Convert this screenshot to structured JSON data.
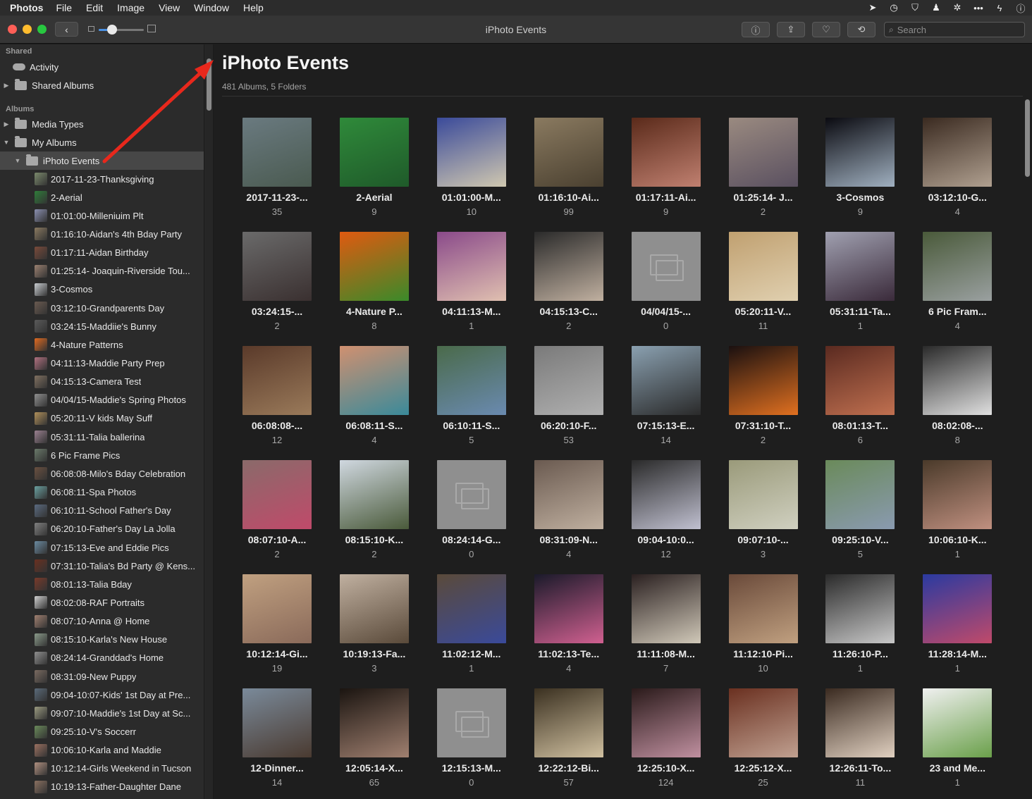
{
  "menubar": {
    "app": "Photos",
    "items": [
      "File",
      "Edit",
      "Image",
      "View",
      "Window",
      "Help"
    ],
    "status_icons": [
      "location-arrow-icon",
      "clock-icon",
      "shield-icon",
      "user-icon",
      "gear-icon",
      "dots-icon",
      "bolt-icon",
      "info-icon"
    ]
  },
  "toolbar": {
    "title": "iPhoto Events",
    "zoom_level": 0.3,
    "search_placeholder": "Search",
    "buttons": [
      "info-icon",
      "share-icon",
      "heart-icon",
      "rotate-icon"
    ]
  },
  "sidebar": {
    "shared_header": "Shared",
    "activity": "Activity",
    "shared_albums": "Shared Albums",
    "albums_header": "Albums",
    "media_types": "Media Types",
    "my_albums": "My Albums",
    "iphoto_events": "iPhoto Events",
    "events": [
      {
        "name": "2017-11-23-Thanksgiving",
        "color": "#7b8a6c"
      },
      {
        "name": "2-Aerial",
        "color": "#2f7d3a"
      },
      {
        "name": "01:01:00-Milleniuim Plt",
        "color": "#8a8fb0"
      },
      {
        "name": "01:16:10-Aidan's 4th Bday Party",
        "color": "#8a7a60"
      },
      {
        "name": "01:17:11-Aidan Birthday",
        "color": "#7a4a3a"
      },
      {
        "name": "01:25:14- Joaquin-Riverside Tou...",
        "color": "#9a8070"
      },
      {
        "name": "3-Cosmos",
        "color": "#c8ccd0"
      },
      {
        "name": "03:12:10-Grandparents Day",
        "color": "#6a5a50"
      },
      {
        "name": "03:24:15-Maddiie's Bunny",
        "color": "#5a5a5a"
      },
      {
        "name": "4-Nature Patterns",
        "color": "#e06a20"
      },
      {
        "name": "04:11:13-Maddie Party Prep",
        "color": "#b07080"
      },
      {
        "name": "04:15:13-Camera Test",
        "color": "#807060"
      },
      {
        "name": "04/04/15-Maddie's Spring Photos",
        "color": "#8f8f8f"
      },
      {
        "name": "05:20:11-V kids May Suff",
        "color": "#b0905a"
      },
      {
        "name": "05:31:11-Talia ballerina",
        "color": "#9a8090"
      },
      {
        "name": "6 Pic Frame Pics",
        "color": "#6a7a6a"
      },
      {
        "name": "06:08:08-Milo's Bday Celebration",
        "color": "#6a5040"
      },
      {
        "name": "06:08:11-Spa Photos",
        "color": "#6aa0a0"
      },
      {
        "name": "06:10:11-School Father's Day",
        "color": "#5a6a80"
      },
      {
        "name": "06:20:10-Father's Day La Jolla",
        "color": "#808080"
      },
      {
        "name": "07:15:13-Eve and Eddie Pics",
        "color": "#6a8aa0"
      },
      {
        "name": "07:31:10-Talia's Bd Party @ Kens...",
        "color": "#6a3020"
      },
      {
        "name": "08:01:13-Talia Bday",
        "color": "#7a3a2a"
      },
      {
        "name": "08:02:08-RAF Portraits",
        "color": "#d0d0d0"
      },
      {
        "name": "08:07:10-Anna @ Home",
        "color": "#a08070"
      },
      {
        "name": "08:15:10-Karla's New House",
        "color": "#8a9a8a"
      },
      {
        "name": "08:24:14-Granddad's Home",
        "color": "#8f8f8f"
      },
      {
        "name": "08:31:09-New Puppy",
        "color": "#7a6a60"
      },
      {
        "name": "09:04-10:07-Kids' 1st Day at Pre...",
        "color": "#5a6a7a"
      },
      {
        "name": "09:07:10-Maddie's 1st Day at Sc...",
        "color": "#9a9a80"
      },
      {
        "name": "09:25:10-V's Soccerr",
        "color": "#6a8a5a"
      },
      {
        "name": "10:06:10-Karla and Maddie",
        "color": "#9a7060"
      },
      {
        "name": "10:12:14-Girls Weekend in Tucson",
        "color": "#b09080"
      },
      {
        "name": "10:19:13-Father-Daughter Dane",
        "color": "#8a7060"
      }
    ]
  },
  "main": {
    "title": "iPhoto Events",
    "subtitle": "481 Albums, 5 Folders",
    "albums": [
      {
        "name": "2017-11-23-...",
        "count": "35",
        "c1": "#6a7a80",
        "c2": "#4a5a50"
      },
      {
        "name": "2-Aerial",
        "count": "9",
        "c1": "#2f8a3a",
        "c2": "#1f5a2a"
      },
      {
        "name": "01:01:00-M...",
        "count": "10",
        "c1": "#3a4a9a",
        "c2": "#d0c8b0"
      },
      {
        "name": "01:16:10-Ai...",
        "count": "99",
        "c1": "#8a7a60",
        "c2": "#4a4030"
      },
      {
        "name": "01:17:11-Ai...",
        "count": "9",
        "c1": "#5a2a1a",
        "c2": "#c08070"
      },
      {
        "name": "01:25:14- J...",
        "count": "2",
        "c1": "#9a8a80",
        "c2": "#5a5060"
      },
      {
        "name": "3-Cosmos",
        "count": "9",
        "c1": "#0a0a10",
        "c2": "#a0b0c0"
      },
      {
        "name": "03:12:10-G...",
        "count": "4",
        "c1": "#3a2a20",
        "c2": "#b0a090"
      },
      {
        "name": "03:24:15-...",
        "count": "2",
        "c1": "#6a6a6a",
        "c2": "#3a3030"
      },
      {
        "name": "4-Nature P...",
        "count": "8",
        "c1": "#e05a10",
        "c2": "#3a8a2a"
      },
      {
        "name": "04:11:13-M...",
        "count": "1",
        "c1": "#8a4a8a",
        "c2": "#e0c0b0"
      },
      {
        "name": "04:15:13-C...",
        "count": "2",
        "c1": "#2a2a2a",
        "c2": "#c0b0a0"
      },
      {
        "name": "04/04/15-...",
        "count": "0",
        "empty": true
      },
      {
        "name": "05:20:11-V...",
        "count": "11",
        "c1": "#c0a070",
        "c2": "#e0d0b0"
      },
      {
        "name": "05:31:11-Ta...",
        "count": "1",
        "c1": "#a0a0b0",
        "c2": "#3a2a3a"
      },
      {
        "name": "6 Pic Fram...",
        "count": "4",
        "c1": "#4a5a3a",
        "c2": "#9aa0a0"
      },
      {
        "name": "06:08:08-...",
        "count": "12",
        "c1": "#5a3a2a",
        "c2": "#9a7a5a"
      },
      {
        "name": "06:08:11-S...",
        "count": "4",
        "c1": "#d09070",
        "c2": "#3a8a9a"
      },
      {
        "name": "06:10:11-S...",
        "count": "5",
        "c1": "#4a6a4a",
        "c2": "#6a8ab0"
      },
      {
        "name": "06:20:10-F...",
        "count": "53",
        "c1": "#7a7a7a",
        "c2": "#b0b0b0"
      },
      {
        "name": "07:15:13-E...",
        "count": "14",
        "c1": "#8aa0b0",
        "c2": "#2a2a2a"
      },
      {
        "name": "07:31:10-T...",
        "count": "2",
        "c1": "#1a1010",
        "c2": "#e07020"
      },
      {
        "name": "08:01:13-T...",
        "count": "6",
        "c1": "#5a2a20",
        "c2": "#c07050"
      },
      {
        "name": "08:02:08-...",
        "count": "8",
        "c1": "#2a2a2a",
        "c2": "#e0e0e0"
      },
      {
        "name": "08:07:10-A...",
        "count": "2",
        "c1": "#8a6a6a",
        "c2": "#c04a6a"
      },
      {
        "name": "08:15:10-K...",
        "count": "2",
        "c1": "#d0d8e0",
        "c2": "#4a5a3a"
      },
      {
        "name": "08:24:14-G...",
        "count": "0",
        "empty": true
      },
      {
        "name": "08:31:09-N...",
        "count": "4",
        "c1": "#6a5a50",
        "c2": "#c0b0a0"
      },
      {
        "name": "09:04-10:0...",
        "count": "12",
        "c1": "#2a2a2a",
        "c2": "#c0c0d0"
      },
      {
        "name": "09:07:10-...",
        "count": "3",
        "c1": "#9a9a7a",
        "c2": "#d0d0c0"
      },
      {
        "name": "09:25:10-V...",
        "count": "5",
        "c1": "#6a8a5a",
        "c2": "#8a9ab0"
      },
      {
        "name": "10:06:10-K...",
        "count": "1",
        "c1": "#4a3a2a",
        "c2": "#c09080"
      },
      {
        "name": "10:12:14-Gi...",
        "count": "19",
        "c1": "#c0a080",
        "c2": "#8a6a5a"
      },
      {
        "name": "10:19:13-Fa...",
        "count": "3",
        "c1": "#c0b0a0",
        "c2": "#5a4a3a"
      },
      {
        "name": "11:02:12-M...",
        "count": "1",
        "c1": "#5a4a3a",
        "c2": "#3a4a9a"
      },
      {
        "name": "11:02:13-Te...",
        "count": "4",
        "c1": "#1a1a2a",
        "c2": "#d06090"
      },
      {
        "name": "11:11:08-M...",
        "count": "7",
        "c1": "#2a2020",
        "c2": "#d0c8b8"
      },
      {
        "name": "11:12:10-Pi...",
        "count": "10",
        "c1": "#6a4a3a",
        "c2": "#c0a080"
      },
      {
        "name": "11:26:10-P...",
        "count": "1",
        "c1": "#2a2a2a",
        "c2": "#c8c8c8"
      },
      {
        "name": "11:28:14-M...",
        "count": "1",
        "c1": "#2a3aa0",
        "c2": "#c04a6a"
      },
      {
        "name": "12-Dinner...",
        "count": "14",
        "c1": "#7a8a9a",
        "c2": "#4a3a30"
      },
      {
        "name": "12:05:14-X...",
        "count": "65",
        "c1": "#1a1410",
        "c2": "#a08070"
      },
      {
        "name": "12:15:13-M...",
        "count": "0",
        "empty": true
      },
      {
        "name": "12:22:12-Bi...",
        "count": "57",
        "c1": "#3a3020",
        "c2": "#d0c0a0"
      },
      {
        "name": "12:25:10-X...",
        "count": "124",
        "c1": "#2a1a1a",
        "c2": "#c090a0"
      },
      {
        "name": "12:25:12-X...",
        "count": "25",
        "c1": "#6a3020",
        "c2": "#c0a090"
      },
      {
        "name": "12:26:11-To...",
        "count": "11",
        "c1": "#3a2a20",
        "c2": "#e0d0c0"
      },
      {
        "name": "23 and Me...",
        "count": "1",
        "c1": "#f0f0f0",
        "c2": "#6aa04a"
      }
    ]
  }
}
